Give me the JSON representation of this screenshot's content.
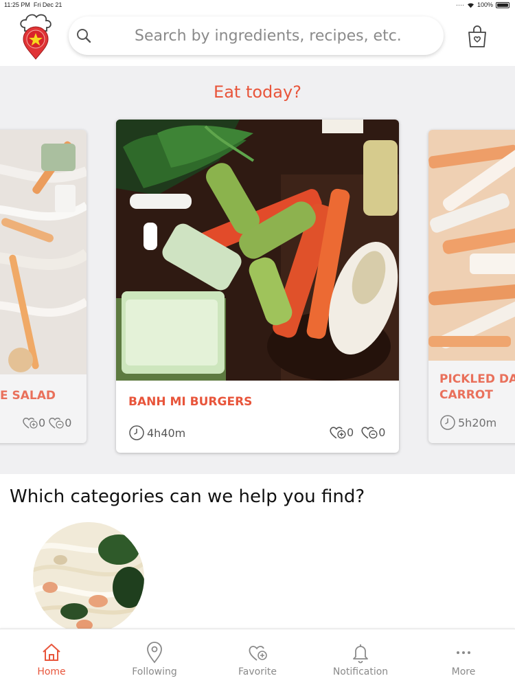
{
  "status_bar": {
    "time": "11:25 PM",
    "date": "Fri Dec 21",
    "battery": "100%"
  },
  "header": {
    "logo_icon": "chef-hat-map-pin-icon",
    "search_placeholder": "Search by ingredients, recipes, etc.",
    "cart_icon": "shopping-bag-icon"
  },
  "featured": {
    "title": "Eat today?",
    "cards": [
      {
        "name": "E SALAD",
        "time": "",
        "likes": "0",
        "dislikes": "0"
      },
      {
        "name": "BANH MI BURGERS",
        "time": "4h40m",
        "likes": "0",
        "dislikes": "0"
      },
      {
        "name_line1": "PICKLED DA",
        "name_line2": "CARROT",
        "time": "5h20m"
      }
    ]
  },
  "categories": {
    "title": "Which categories can we help you find?"
  },
  "nav": {
    "items": [
      {
        "label": "Home",
        "icon": "home-icon",
        "active": true
      },
      {
        "label": "Following",
        "icon": "location-pin-icon",
        "active": false
      },
      {
        "label": "Favorite",
        "icon": "heart-plus-icon",
        "active": false
      },
      {
        "label": "Notification",
        "icon": "bell-icon",
        "active": false
      },
      {
        "label": "More",
        "icon": "more-dots-icon",
        "active": false
      }
    ]
  },
  "colors": {
    "accent": "#e8553b",
    "muted": "#8a8a8a",
    "section_bg": "#f0f0f2"
  }
}
